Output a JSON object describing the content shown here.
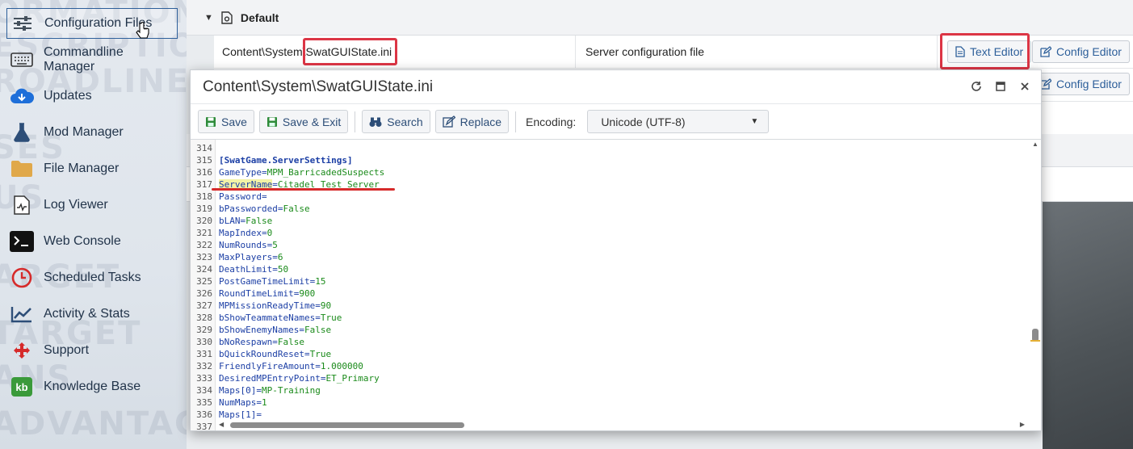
{
  "sidebar": {
    "watermark_lines": [
      "ORMATION",
      "ESCRIPTION",
      "ROADLINES",
      "SES",
      "US",
      "ARGET",
      "TARGET",
      "ANS",
      "ADVANTAGES"
    ],
    "items": [
      {
        "label": "Configuration Files",
        "icon": "sliders-icon",
        "active": true
      },
      {
        "label": "Commandline Manager",
        "icon": "keyboard-icon"
      },
      {
        "label": "Updates",
        "icon": "cloud-download-icon"
      },
      {
        "label": "Mod Manager",
        "icon": "flask-icon"
      },
      {
        "label": "File Manager",
        "icon": "folder-icon"
      },
      {
        "label": "Log Viewer",
        "icon": "log-file-icon"
      },
      {
        "label": "Web Console",
        "icon": "terminal-icon"
      },
      {
        "label": "Scheduled Tasks",
        "icon": "clock-icon"
      },
      {
        "label": "Activity & Stats",
        "icon": "chart-icon"
      },
      {
        "label": "Support",
        "icon": "support-icon"
      },
      {
        "label": "Knowledge Base",
        "icon": "kb-icon"
      }
    ]
  },
  "group": {
    "title": "Default"
  },
  "table_row": {
    "path_prefix": "Content\\System\\",
    "filename": "SwatGUIState.ini",
    "description": "Server configuration file",
    "text_editor_label": "Text Editor",
    "config_editor_label": "Config Editor"
  },
  "editor": {
    "title": "Content\\System\\SwatGUIState.ini",
    "toolbar": {
      "save": "Save",
      "save_exit": "Save & Exit",
      "search": "Search",
      "replace": "Replace",
      "encoding_label": "Encoding:",
      "encoding_value": "Unicode (UTF-8)"
    },
    "lines": [
      {
        "n": "314",
        "k": "",
        "v": ""
      },
      {
        "n": "315",
        "section": "[SwatGame.ServerSettings]"
      },
      {
        "n": "316",
        "k": "GameType",
        "v": "MPM_BarricadedSuspects"
      },
      {
        "n": "317",
        "k": "ServerName",
        "v": "Citadel Test Server",
        "highlight": true
      },
      {
        "n": "318",
        "k": "Password",
        "v": ""
      },
      {
        "n": "319",
        "k": "bPassworded",
        "v": "False"
      },
      {
        "n": "320",
        "k": "bLAN",
        "v": "False"
      },
      {
        "n": "321",
        "k": "MapIndex",
        "v": "0"
      },
      {
        "n": "322",
        "k": "NumRounds",
        "v": "5"
      },
      {
        "n": "323",
        "k": "MaxPlayers",
        "v": "6"
      },
      {
        "n": "324",
        "k": "DeathLimit",
        "v": "50"
      },
      {
        "n": "325",
        "k": "PostGameTimeLimit",
        "v": "15"
      },
      {
        "n": "326",
        "k": "RoundTimeLimit",
        "v": "900"
      },
      {
        "n": "327",
        "k": "MPMissionReadyTime",
        "v": "90"
      },
      {
        "n": "328",
        "k": "bShowTeammateNames",
        "v": "True"
      },
      {
        "n": "329",
        "k": "bShowEnemyNames",
        "v": "False"
      },
      {
        "n": "330",
        "k": "bNoRespawn",
        "v": "False"
      },
      {
        "n": "331",
        "k": "bQuickRoundReset",
        "v": "True"
      },
      {
        "n": "332",
        "k": "FriendlyFireAmount",
        "v": "1.000000"
      },
      {
        "n": "333",
        "k": "DesiredMPEntryPoint",
        "v": "ET_Primary"
      },
      {
        "n": "334",
        "k": "Maps[0]",
        "v": "MP-Training"
      },
      {
        "n": "335",
        "k": "NumMaps",
        "v": "1"
      },
      {
        "n": "336",
        "k": "Maps[1]",
        "v": ""
      },
      {
        "n": "337",
        "k": "",
        "v": ""
      }
    ]
  },
  "colors": {
    "accent": "#2d5f9a",
    "annotation_red": "#dc3545",
    "key": "#1c3fa5",
    "value": "#1a8a1a"
  }
}
